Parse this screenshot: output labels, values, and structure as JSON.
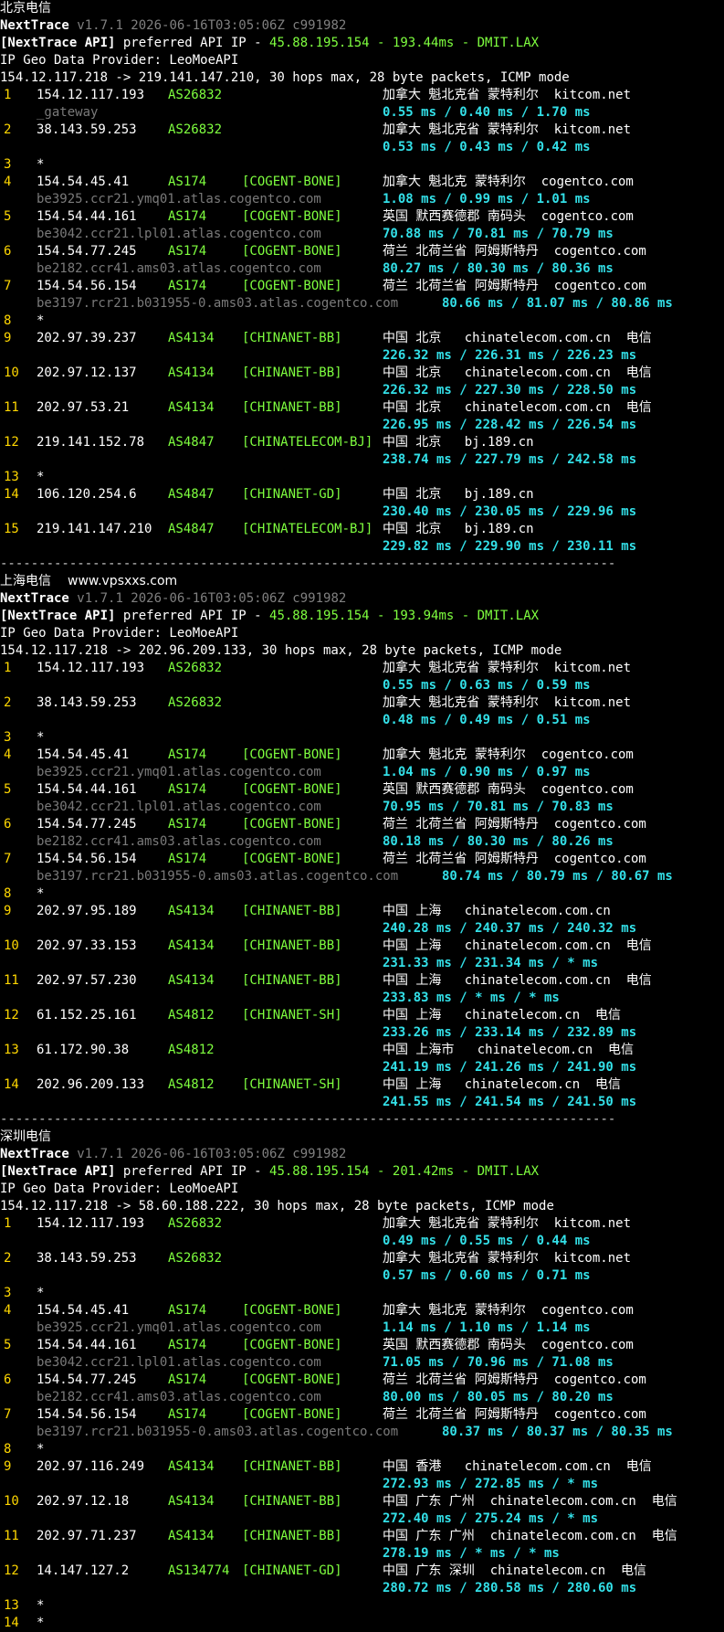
{
  "watermark": "www.vpsxxs.com",
  "separator": "--------------------------------------------------------------------------------",
  "sections": [
    {
      "title": "北京电信",
      "version_label": "NextTrace",
      "version_info": "v1.7.1 2026-06-16T03:05:06Z c991982",
      "api_prefix": "[NextTrace API]",
      "api_text": " preferred API IP - ",
      "api_ip": "45.88.195.154",
      "api_dash1": " - ",
      "api_latency": "193.44ms",
      "api_dash2": " - ",
      "api_node": "DMIT.LAX",
      "geo_provider": "IP Geo Data Provider: LeoMoeAPI",
      "route": "154.12.117.218 -> 219.141.147.210, 30 hops max, 28 byte packets, ICMP mode",
      "hops": [
        {
          "n": "1",
          "ip": "154.12.117.193",
          "as": "AS26832",
          "net": "",
          "geo": "加拿大 魁北克省 蒙特利尔  kitcom.net",
          "host": "_gateway",
          "rtt": "0.55 ms / 0.40 ms / 1.70 ms"
        },
        {
          "n": "2",
          "ip": "38.143.59.253",
          "as": "AS26832",
          "net": "",
          "geo": "加拿大 魁北克省 蒙特利尔  kitcom.net",
          "host": "",
          "rtt": "0.53 ms / 0.43 ms / 0.42 ms"
        },
        {
          "n": "3",
          "ip": "*"
        },
        {
          "n": "4",
          "ip": "154.54.45.41",
          "as": "AS174",
          "net": "[COGENT-BONE]",
          "geo": "加拿大 魁北克 蒙特利尔  cogentco.com",
          "host": "be3925.ccr21.ymq01.atlas.cogentco.com",
          "rtt": "1.08 ms / 0.99 ms / 1.01 ms"
        },
        {
          "n": "5",
          "ip": "154.54.44.161",
          "as": "AS174",
          "net": "[COGENT-BONE]",
          "geo": "英国 默西赛德郡 南码头  cogentco.com",
          "host": "be3042.ccr21.lpl01.atlas.cogentco.com",
          "rtt": "70.88 ms / 70.81 ms / 70.79 ms"
        },
        {
          "n": "6",
          "ip": "154.54.77.245",
          "as": "AS174",
          "net": "[COGENT-BONE]",
          "geo": "荷兰 北荷兰省 阿姆斯特丹  cogentco.com",
          "host": "be2182.ccr41.ams03.atlas.cogentco.com",
          "rtt": "80.27 ms / 80.30 ms / 80.36 ms"
        },
        {
          "n": "7",
          "ip": "154.54.56.154",
          "as": "AS174",
          "net": "[COGENT-BONE]",
          "geo": "荷兰 北荷兰省 阿姆斯特丹  cogentco.com",
          "host": "be3197.rcr21.b031955-0.ams03.atlas.cogentco.com",
          "rtt_inline": "80.66 ms / 81.07 ms / 80.86 ms"
        },
        {
          "n": "8",
          "ip": "*"
        },
        {
          "n": "9",
          "ip": "202.97.39.237",
          "as": "AS4134",
          "net": "[CHINANET-BB]",
          "geo": "中国 北京   chinatelecom.com.cn  电信",
          "host": "",
          "rtt": "226.32 ms / 226.31 ms / 226.23 ms"
        },
        {
          "n": "10",
          "ip": "202.97.12.137",
          "as": "AS4134",
          "net": "[CHINANET-BB]",
          "geo": "中国 北京   chinatelecom.com.cn  电信",
          "host": "",
          "rtt": "226.32 ms / 227.30 ms / 228.50 ms"
        },
        {
          "n": "11",
          "ip": "202.97.53.21",
          "as": "AS4134",
          "net": "[CHINANET-BB]",
          "geo": "中国 北京   chinatelecom.com.cn  电信",
          "host": "",
          "rtt": "226.95 ms / 228.42 ms / 226.54 ms"
        },
        {
          "n": "12",
          "ip": "219.141.152.78",
          "as": "AS4847",
          "net": "[CHINATELECOM-BJ]",
          "geo": "中国 北京   bj.189.cn",
          "host": "",
          "rtt": "238.74 ms / 227.79 ms / 242.58 ms"
        },
        {
          "n": "13",
          "ip": "*"
        },
        {
          "n": "14",
          "ip": "106.120.254.6",
          "as": "AS4847",
          "net": "[CHINANET-GD]",
          "geo": "中国 北京   bj.189.cn",
          "host": "",
          "rtt": "230.40 ms / 230.05 ms / 229.96 ms"
        },
        {
          "n": "15",
          "ip": "219.141.147.210",
          "as": "AS4847",
          "net": "[CHINATELECOM-BJ]",
          "geo": "中国 北京   bj.189.cn",
          "host": "",
          "rtt": "229.82 ms / 229.90 ms / 230.11 ms"
        }
      ]
    },
    {
      "title": "上海电信",
      "version_label": "NextTrace",
      "version_info": "v1.7.1 2026-06-16T03:05:06Z c991982",
      "api_prefix": "[NextTrace API]",
      "api_text": " preferred API IP - ",
      "api_ip": "45.88.195.154",
      "api_dash1": " - ",
      "api_latency": "193.94ms",
      "api_dash2": " - ",
      "api_node": "DMIT.LAX",
      "geo_provider": "IP Geo Data Provider: LeoMoeAPI",
      "route": "154.12.117.218 -> 202.96.209.133, 30 hops max, 28 byte packets, ICMP mode",
      "hops": [
        {
          "n": "1",
          "ip": "154.12.117.193",
          "as": "AS26832",
          "net": "",
          "geo": "加拿大 魁北克省 蒙特利尔  kitcom.net",
          "host": "",
          "rtt": "0.55 ms / 0.63 ms / 0.59 ms"
        },
        {
          "n": "2",
          "ip": "38.143.59.253",
          "as": "AS26832",
          "net": "",
          "geo": "加拿大 魁北克省 蒙特利尔  kitcom.net",
          "host": "",
          "rtt": "0.48 ms / 0.49 ms / 0.51 ms"
        },
        {
          "n": "3",
          "ip": "*"
        },
        {
          "n": "4",
          "ip": "154.54.45.41",
          "as": "AS174",
          "net": "[COGENT-BONE]",
          "geo": "加拿大 魁北克 蒙特利尔  cogentco.com",
          "host": "be3925.ccr21.ymq01.atlas.cogentco.com",
          "rtt": "1.04 ms / 0.90 ms / 0.97 ms"
        },
        {
          "n": "5",
          "ip": "154.54.44.161",
          "as": "AS174",
          "net": "[COGENT-BONE]",
          "geo": "英国 默西赛德郡 南码头  cogentco.com",
          "host": "be3042.ccr21.lpl01.atlas.cogentco.com",
          "rtt": "70.95 ms / 70.81 ms / 70.83 ms"
        },
        {
          "n": "6",
          "ip": "154.54.77.245",
          "as": "AS174",
          "net": "[COGENT-BONE]",
          "geo": "荷兰 北荷兰省 阿姆斯特丹  cogentco.com",
          "host": "be2182.ccr41.ams03.atlas.cogentco.com",
          "rtt": "80.18 ms / 80.30 ms / 80.26 ms"
        },
        {
          "n": "7",
          "ip": "154.54.56.154",
          "as": "AS174",
          "net": "[COGENT-BONE]",
          "geo": "荷兰 北荷兰省 阿姆斯特丹  cogentco.com",
          "host": "be3197.rcr21.b031955-0.ams03.atlas.cogentco.com",
          "rtt_inline": "80.74 ms / 80.79 ms / 80.67 ms"
        },
        {
          "n": "8",
          "ip": "*"
        },
        {
          "n": "9",
          "ip": "202.97.95.189",
          "as": "AS4134",
          "net": "[CHINANET-BB]",
          "geo": "中国 上海   chinatelecom.com.cn",
          "host": "",
          "rtt": "240.28 ms / 240.37 ms / 240.32 ms"
        },
        {
          "n": "10",
          "ip": "202.97.33.153",
          "as": "AS4134",
          "net": "[CHINANET-BB]",
          "geo": "中国 上海   chinatelecom.com.cn  电信",
          "host": "",
          "rtt": "231.33 ms / 231.34 ms / * ms"
        },
        {
          "n": "11",
          "ip": "202.97.57.230",
          "as": "AS4134",
          "net": "[CHINANET-BB]",
          "geo": "中国 上海   chinatelecom.com.cn  电信",
          "host": "",
          "rtt": "233.83 ms / * ms / * ms"
        },
        {
          "n": "12",
          "ip": "61.152.25.161",
          "as": "AS4812",
          "net": "[CHINANET-SH]",
          "geo": "中国 上海   chinatelecom.cn  电信",
          "host": "",
          "rtt": "233.26 ms / 233.14 ms / 232.89 ms"
        },
        {
          "n": "13",
          "ip": "61.172.90.38",
          "as": "AS4812",
          "net": "",
          "geo": "中国 上海市   chinatelecom.cn  电信",
          "host": "",
          "rtt": "241.19 ms / 241.26 ms / 241.90 ms"
        },
        {
          "n": "14",
          "ip": "202.96.209.133",
          "as": "AS4812",
          "net": "[CHINANET-SH]",
          "geo": "中国 上海   chinatelecom.cn  电信",
          "host": "",
          "rtt": "241.55 ms / 241.54 ms / 241.50 ms"
        }
      ]
    },
    {
      "title": "深圳电信",
      "version_label": "NextTrace",
      "version_info": "v1.7.1 2026-06-16T03:05:06Z c991982",
      "api_prefix": "[NextTrace API]",
      "api_text": " preferred API IP - ",
      "api_ip": "45.88.195.154",
      "api_dash1": " - ",
      "api_latency": "201.42ms",
      "api_dash2": " - ",
      "api_node": "DMIT.LAX",
      "geo_provider": "IP Geo Data Provider: LeoMoeAPI",
      "route": "154.12.117.218 -> 58.60.188.222, 30 hops max, 28 byte packets, ICMP mode",
      "hops": [
        {
          "n": "1",
          "ip": "154.12.117.193",
          "as": "AS26832",
          "net": "",
          "geo": "加拿大 魁北克省 蒙特利尔  kitcom.net",
          "host": "",
          "rtt": "0.49 ms / 0.55 ms / 0.44 ms"
        },
        {
          "n": "2",
          "ip": "38.143.59.253",
          "as": "AS26832",
          "net": "",
          "geo": "加拿大 魁北克省 蒙特利尔  kitcom.net",
          "host": "",
          "rtt": "0.57 ms / 0.60 ms / 0.71 ms"
        },
        {
          "n": "3",
          "ip": "*"
        },
        {
          "n": "4",
          "ip": "154.54.45.41",
          "as": "AS174",
          "net": "[COGENT-BONE]",
          "geo": "加拿大 魁北克 蒙特利尔  cogentco.com",
          "host": "be3925.ccr21.ymq01.atlas.cogentco.com",
          "rtt": "1.14 ms / 1.10 ms / 1.14 ms"
        },
        {
          "n": "5",
          "ip": "154.54.44.161",
          "as": "AS174",
          "net": "[COGENT-BONE]",
          "geo": "英国 默西赛德郡 南码头  cogentco.com",
          "host": "be3042.ccr21.lpl01.atlas.cogentco.com",
          "rtt": "71.05 ms / 70.96 ms / 71.08 ms"
        },
        {
          "n": "6",
          "ip": "154.54.77.245",
          "as": "AS174",
          "net": "[COGENT-BONE]",
          "geo": "荷兰 北荷兰省 阿姆斯特丹  cogentco.com",
          "host": "be2182.ccr41.ams03.atlas.cogentco.com",
          "rtt": "80.00 ms / 80.05 ms / 80.20 ms"
        },
        {
          "n": "7",
          "ip": "154.54.56.154",
          "as": "AS174",
          "net": "[COGENT-BONE]",
          "geo": "荷兰 北荷兰省 阿姆斯特丹  cogentco.com",
          "host": "be3197.rcr21.b031955-0.ams03.atlas.cogentco.com",
          "rtt_inline": "80.37 ms / 80.37 ms / 80.35 ms"
        },
        {
          "n": "8",
          "ip": "*"
        },
        {
          "n": "9",
          "ip": "202.97.116.249",
          "as": "AS4134",
          "net": "[CHINANET-BB]",
          "geo": "中国 香港   chinatelecom.com.cn  电信",
          "host": "",
          "rtt": "272.93 ms / 272.85 ms / * ms"
        },
        {
          "n": "10",
          "ip": "202.97.12.18",
          "as": "AS4134",
          "net": "[CHINANET-BB]",
          "geo": "中国 广东 广州  chinatelecom.com.cn  电信",
          "host": "",
          "rtt": "272.40 ms / 275.24 ms / * ms"
        },
        {
          "n": "11",
          "ip": "202.97.71.237",
          "as": "AS4134",
          "net": "[CHINANET-BB]",
          "geo": "中国 广东 广州  chinatelecom.com.cn  电信",
          "host": "",
          "rtt": "278.19 ms / * ms / * ms"
        },
        {
          "n": "12",
          "ip": "14.147.127.2",
          "as": "AS134774",
          "net": "[CHINANET-GD]",
          "geo": "中国 广东 深圳  chinatelecom.cn  电信",
          "host": "",
          "rtt": "280.72 ms / 280.58 ms / 280.60 ms"
        },
        {
          "n": "13",
          "ip": "*"
        },
        {
          "n": "14",
          "ip": "*"
        }
      ]
    }
  ]
}
